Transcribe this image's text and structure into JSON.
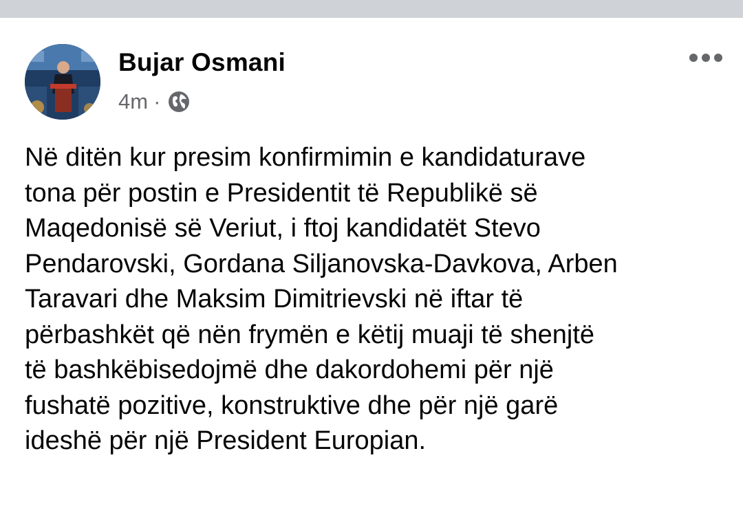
{
  "post": {
    "author": "Bujar Osmani",
    "time": "4m",
    "separator": "·",
    "privacy_icon": "globe-icon",
    "more_icon": "more-options-icon",
    "avatar_icon": "profile-photo",
    "text_lines": [
      "Në ditën kur presim konfirmimin e kandidaturave",
      "tona për postin e Presidentit të Republikë së",
      "Maqedonisë së Veriut, i ftoj kandidatët Stevo",
      "Pendarovski, Gordana Siljanovska-Davkova, Arben",
      "Taravari dhe Maksim Dimitrievski në iftar të",
      "përbashkët që nën frymën e këtij muaji të shenjtë",
      "të bashkëbisedojmë dhe dakordohemi për një",
      "fushatë pozitive, konstruktive dhe për një garë",
      "ideshë për një President Europian."
    ]
  },
  "colors": {
    "top_strip": "#cfd2d6",
    "text": "#050505",
    "secondary_text": "#65676b",
    "background": "#ffffff"
  }
}
